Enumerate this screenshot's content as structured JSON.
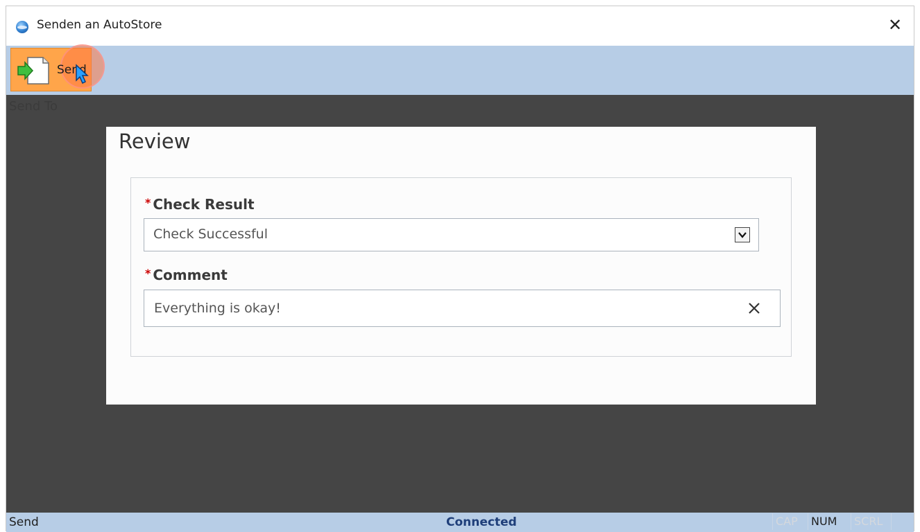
{
  "window": {
    "title": "Senden an AutoStore",
    "close_icon": "close-icon"
  },
  "toolbar": {
    "send_label": "Send",
    "send_icon": "document-send-icon",
    "active_color": "#ffa54a"
  },
  "panel": {
    "section_label": "Send To"
  },
  "form": {
    "title": "Review",
    "check_result": {
      "required_marker": "*",
      "label": "Check Result",
      "value": "Check Successful"
    },
    "comment": {
      "required_marker": "*",
      "label": "Comment",
      "value": "Everything is okay!"
    }
  },
  "statusbar": {
    "left": "Send",
    "center": "Connected",
    "indicators": {
      "cap": "CAP",
      "num": "NUM",
      "scrl": "SCRL"
    }
  },
  "colors": {
    "toolbar_bg": "#b7cde6",
    "content_bg": "#454545",
    "required": "#cc0000"
  }
}
